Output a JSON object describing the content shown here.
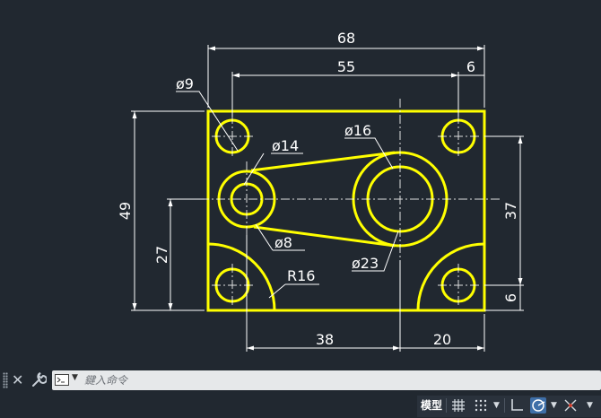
{
  "drawing": {
    "dimensions": {
      "overall_width": "68",
      "hole_spacing": "55",
      "edge_offset_right": "6",
      "overall_height": "49",
      "hole_height": "37",
      "center_height": "27",
      "bottom_offset": "6",
      "left_span": "38",
      "right_span": "20",
      "small_hole_dia": "ø9",
      "boss_outer_dia": "ø14",
      "boss_inner_dia": "ø8",
      "big_boss_inner_dia": "ø16",
      "big_boss_outer_dia": "ø23",
      "corner_radius": "R16"
    },
    "colors": {
      "geometry": "#ffff00",
      "dims": "#ffffff",
      "background": "#212830"
    }
  },
  "command_line": {
    "placeholder": "鍵入命令",
    "icons": [
      "grip-icon",
      "close-icon",
      "wrench-icon",
      "command-prompt-icon"
    ]
  },
  "status_bar": {
    "model_tab": "模型",
    "icons": [
      "grid-icon",
      "snap-icon",
      "ortho-icon",
      "polar-icon",
      "osnap-icon"
    ]
  }
}
